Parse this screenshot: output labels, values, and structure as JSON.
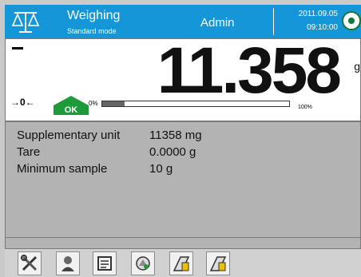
{
  "header": {
    "title": "Weighing",
    "subtitle": "Standard mode",
    "user": "Admin",
    "date": "2011.09.05",
    "time": "09:10:00"
  },
  "weighing": {
    "value": "11.358",
    "unit": "g",
    "zero_indicator": "→0←",
    "ok_label": "OK",
    "progress_min_label": "0%",
    "progress_max_label": "100%",
    "progress_fraction": 0.12
  },
  "info": {
    "rows": [
      {
        "label": "Supplementary unit",
        "value": "11358 mg"
      },
      {
        "label": "Tare",
        "value": "0.0000 g"
      },
      {
        "label": "Minimum sample",
        "value": "10 g"
      }
    ]
  },
  "toolbar": {
    "icons": [
      "tools-icon",
      "user-icon",
      "printer-icon",
      "tare-icon",
      "weight-database-icon",
      "product-database-icon"
    ]
  },
  "colors": {
    "header_bg": "#1596d8",
    "ok_green": "#1e9a3b"
  }
}
